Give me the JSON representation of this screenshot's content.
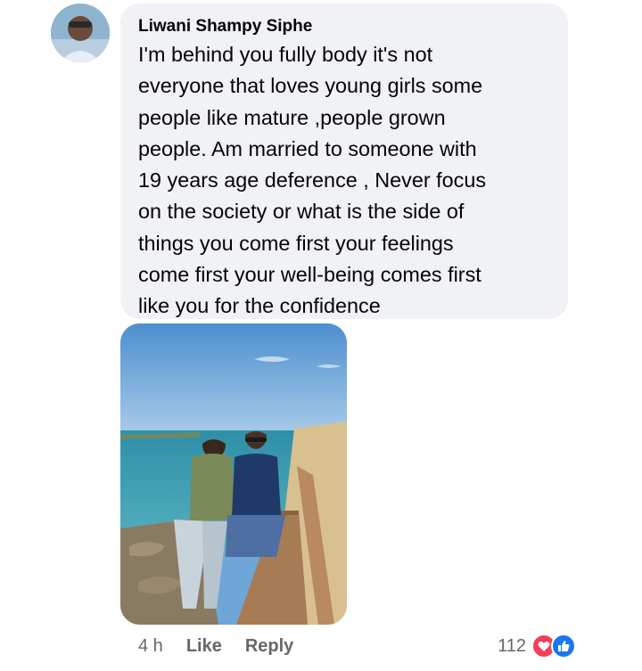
{
  "comment": {
    "author": "Liwani Shampy Siphe",
    "lines": [
      "I'm behind you fully body it's not",
      "everyone that loves young girls some",
      "people like mature ,people grown",
      "people. Am married to someone with",
      "19 years age deference , Never focus",
      "on the society or what is the side of",
      "things you come first your feelings",
      "come first your well-being comes first",
      "like you for the confidence"
    ]
  },
  "actions": {
    "time": "4 h",
    "like": "Like",
    "reply": "Reply"
  },
  "reactions": {
    "count": "112",
    "icons": [
      "love-icon",
      "like-icon"
    ]
  },
  "colors": {
    "bubble": "#f0f2f5",
    "meta_text": "#65676b",
    "like_blue": "#1877f2",
    "love_red": "#f33e58"
  }
}
